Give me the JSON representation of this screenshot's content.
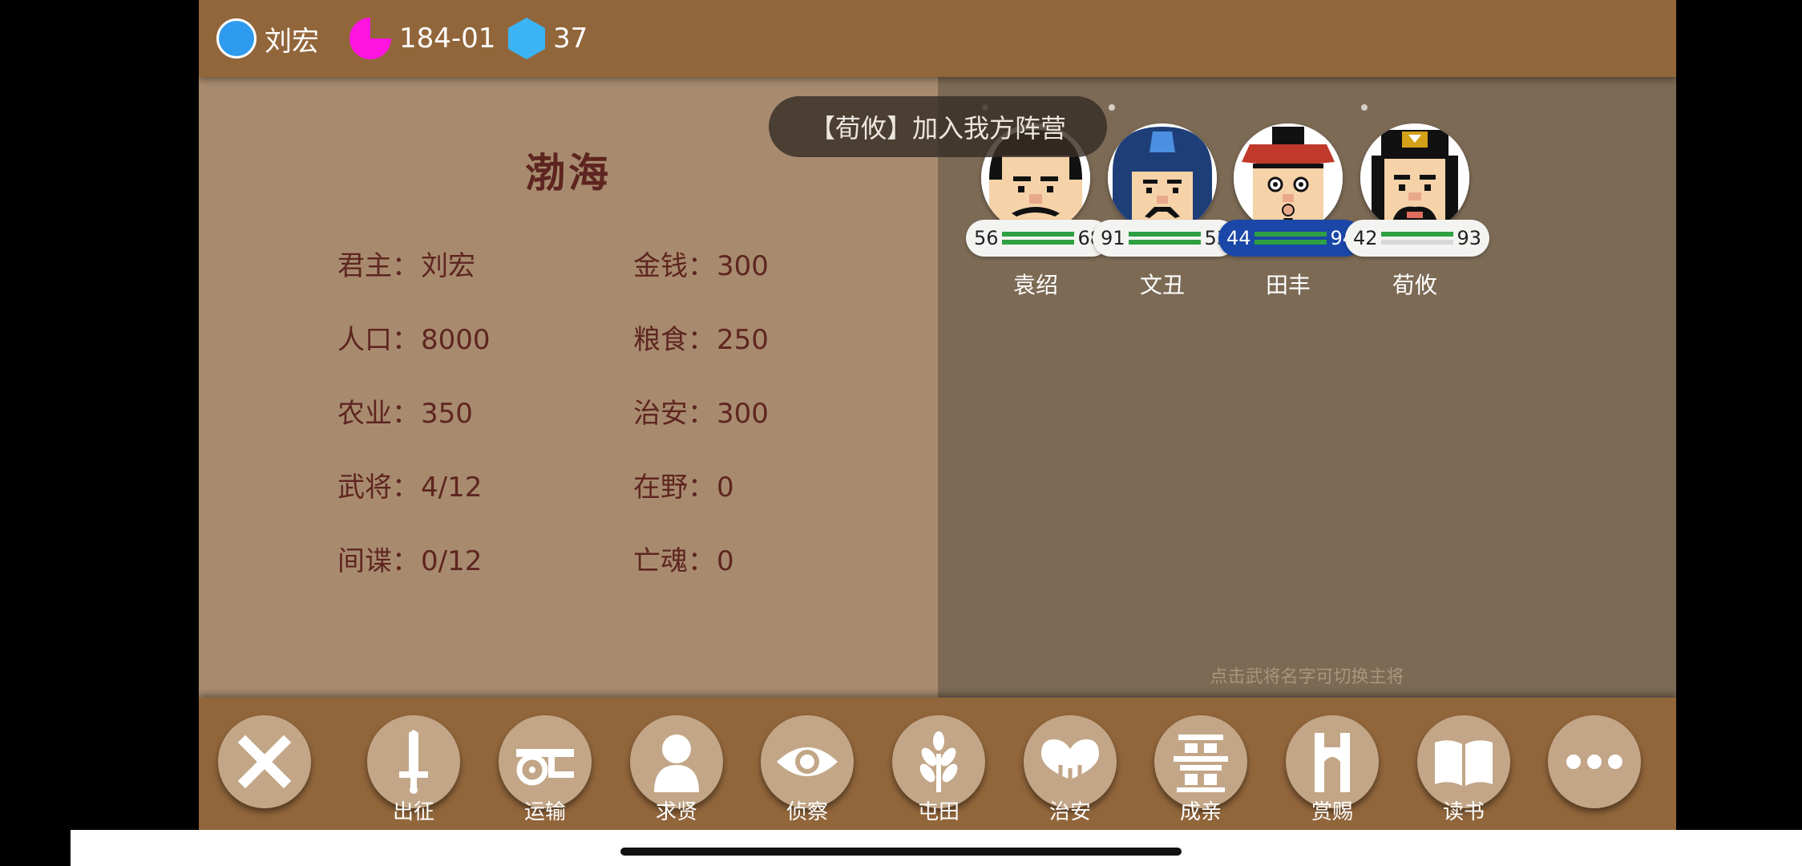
{
  "topbar": {
    "ruler_name": "刘宏",
    "date": "184-01",
    "count": "37",
    "colors": {
      "ruler": "#2f9bef",
      "date": "#ff14e0",
      "hex": "#3cb3f3"
    }
  },
  "city": {
    "name": "渤海",
    "stats": [
      {
        "label": "君主：",
        "value": "刘宏"
      },
      {
        "label": "金钱：",
        "value": "300"
      },
      {
        "label": "人口：",
        "value": "8000"
      },
      {
        "label": "粮食：",
        "value": "250"
      },
      {
        "label": "农业：",
        "value": "350"
      },
      {
        "label": "治安：",
        "value": "300"
      },
      {
        "label": "武将：",
        "value": "4/12"
      },
      {
        "label": "在野：",
        "value": "0"
      },
      {
        "label": "间谍：",
        "value": "0/12"
      },
      {
        "label": "亡魂：",
        "value": "0"
      }
    ]
  },
  "toast": "【荀攸】加入我方阵营",
  "generals": [
    {
      "name": "袁绍",
      "left": "56",
      "right": "68",
      "selected": false
    },
    {
      "name": "文丑",
      "left": "91",
      "right": "53",
      "selected": false
    },
    {
      "name": "田丰",
      "left": "44",
      "right": "94",
      "selected": true
    },
    {
      "name": "荀攸",
      "left": "42",
      "right": "93",
      "selected": false
    }
  ],
  "hint": "点击武将名字可切换主将",
  "actions": [
    {
      "label": "出征",
      "icon": "sword-icon"
    },
    {
      "label": "运输",
      "icon": "cart-icon"
    },
    {
      "label": "求贤",
      "icon": "person-icon"
    },
    {
      "label": "侦察",
      "icon": "eye-icon"
    },
    {
      "label": "屯田",
      "icon": "wheat-icon"
    },
    {
      "label": "治安",
      "icon": "hearts-icon"
    },
    {
      "label": "成亲",
      "icon": "double-happiness-icon"
    },
    {
      "label": "赏赐",
      "icon": "reward-icon"
    },
    {
      "label": "读书",
      "icon": "book-icon"
    }
  ]
}
